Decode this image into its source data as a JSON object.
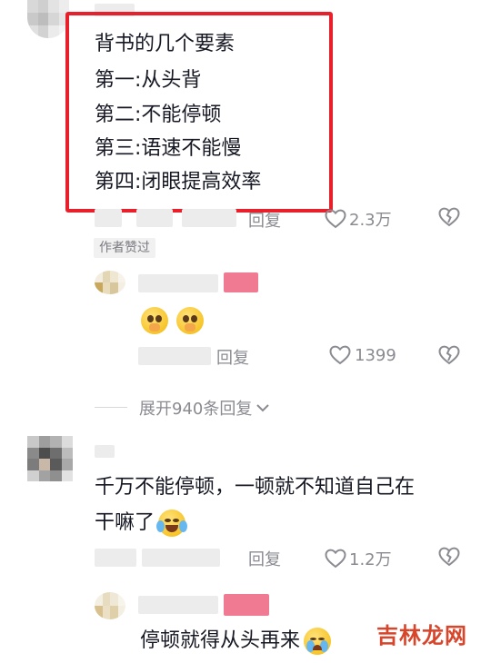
{
  "comment1": {
    "lines": [
      "背书的几个要素",
      "第一:从头背",
      "第二:不能停顿",
      "第三:语速不能慢",
      "第四:闭眼提高效率"
    ],
    "reply_label": "回复",
    "like_count": "2.3万",
    "author_liked_tag": "作者赞过"
  },
  "reply1": {
    "like_count": "1399",
    "reply_label": "回复"
  },
  "expand": {
    "label": "展开940条回复"
  },
  "comment2": {
    "text_line1": "千万不能停顿，一顿就不知道自己在",
    "text_line2": "干嘛了",
    "reply_label": "回复",
    "like_count": "1.2万"
  },
  "reply2": {
    "text": "停顿就得从头再来"
  },
  "watermark": "吉林龙网",
  "colors": {
    "highlight_border": "#e8202b",
    "meta_text": "#8a8b91",
    "main_text": "#161823"
  },
  "icons": [
    "heart-outline-icon",
    "heart-broken-icon",
    "chevron-down-icon"
  ]
}
